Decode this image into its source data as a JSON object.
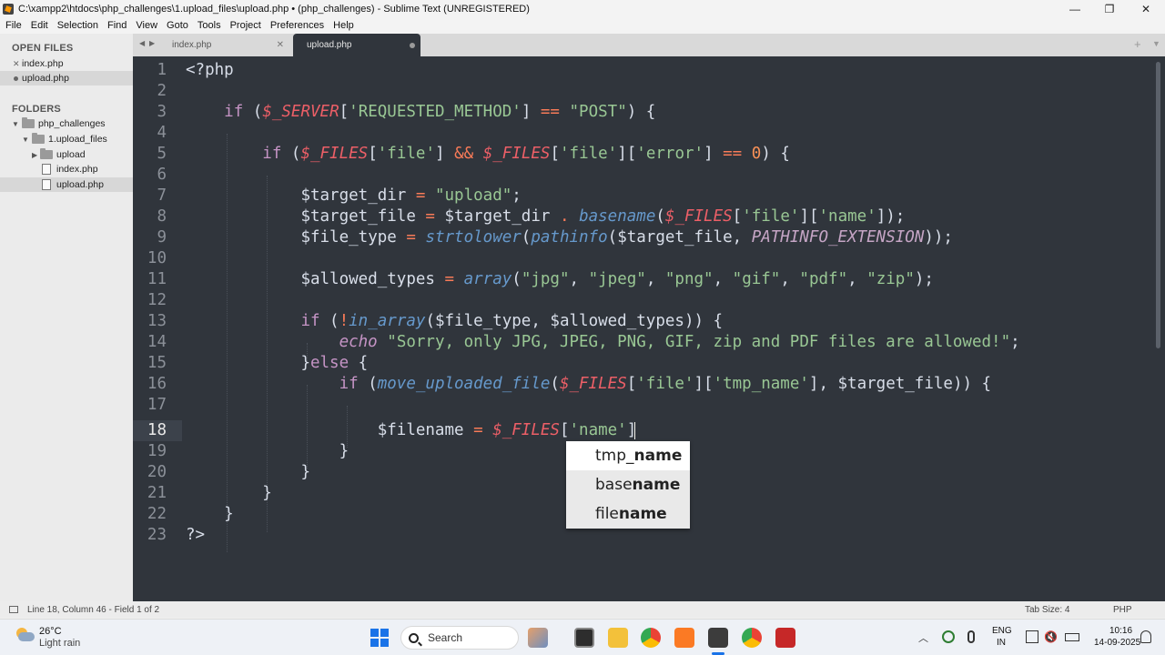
{
  "window": {
    "title": "C:\\xampp2\\htdocs\\php_challenges\\1.upload_files\\upload.php • (php_challenges) - Sublime Text (UNREGISTERED)",
    "min": "—",
    "max": "❐",
    "close": "✕"
  },
  "menu": [
    "File",
    "Edit",
    "Selection",
    "Find",
    "View",
    "Goto",
    "Tools",
    "Project",
    "Preferences",
    "Help"
  ],
  "sidebar": {
    "open_files_header": "OPEN FILES",
    "open_files": [
      {
        "label": "index.php"
      },
      {
        "label": "upload.php"
      }
    ],
    "folders_header": "FOLDERS",
    "tree": [
      {
        "label": "php_challenges"
      },
      {
        "label": "1.upload_files"
      },
      {
        "label": "upload"
      },
      {
        "label": "index.php"
      },
      {
        "label": "upload.php"
      }
    ]
  },
  "tabs": [
    {
      "label": "index.php"
    },
    {
      "label": "upload.php"
    }
  ],
  "gutter": [
    "1",
    "2",
    "3",
    "4",
    "5",
    "6",
    "7",
    "8",
    "9",
    "10",
    "11",
    "12",
    "13",
    "14",
    "15",
    "16",
    "17",
    "18",
    "19",
    "20",
    "21",
    "22",
    "23"
  ],
  "code": {
    "l1": "<?php",
    "l3_if": "if",
    "l3_a": " (",
    "l3_server": "$_SERVER",
    "l3_b": "[",
    "l3_key": "'REQUESTED_METHOD'",
    "l3_c": "] ",
    "l3_eq": "==",
    "l3_d": " ",
    "l3_post": "\"POST\"",
    "l3_e": ") {",
    "l5_if": "if",
    "l5_a": " (",
    "l5_files1": "$_FILES",
    "l5_b": "[",
    "l5_file1": "'file'",
    "l5_c": "] ",
    "l5_and": "&&",
    "l5_d": " ",
    "l5_files2": "$_FILES",
    "l5_e": "[",
    "l5_file2": "'file'",
    "l5_f": "][",
    "l5_error": "'error'",
    "l5_g": "] ",
    "l5_eq": "==",
    "l5_h": " ",
    "l5_zero": "0",
    "l5_i": ") {",
    "l7_var": "$target_dir",
    "l7_a": " ",
    "l7_eq": "=",
    "l7_b": " ",
    "l7_str": "\"upload\"",
    "l7_c": ";",
    "l8_var": "$target_file",
    "l8_a": " ",
    "l8_eq": "=",
    "l8_b": " ",
    "l8_var2": "$target_dir",
    "l8_c": " ",
    "l8_dot": ".",
    "l8_d": " ",
    "l8_fn": "basename",
    "l8_e": "(",
    "l8_files": "$_FILES",
    "l8_f": "[",
    "l8_file": "'file'",
    "l8_g": "][",
    "l8_name": "'name'",
    "l8_h": "]);",
    "l9_var": "$file_type",
    "l9_a": " ",
    "l9_eq": "=",
    "l9_b": " ",
    "l9_fn1": "strtolower",
    "l9_c": "(",
    "l9_fn2": "pathinfo",
    "l9_d": "(",
    "l9_var2": "$target_file",
    "l9_e": ", ",
    "l9_const": "PATHINFO_EXTENSION",
    "l9_f": "));",
    "l11_var": "$allowed_types",
    "l11_a": " ",
    "l11_eq": "=",
    "l11_b": " ",
    "l11_fn": "array",
    "l11_c": "(",
    "l11_s1": "\"jpg\"",
    "l11_d": ", ",
    "l11_s2": "\"jpeg\"",
    "l11_e": ", ",
    "l11_s3": "\"png\"",
    "l11_f": ", ",
    "l11_s4": "\"gif\"",
    "l11_g": ", ",
    "l11_s5": "\"pdf\"",
    "l11_h": ", ",
    "l11_s6": "\"zip\"",
    "l11_i": ");",
    "l13_if": "if",
    "l13_a": " (",
    "l13_not": "!",
    "l13_fn": "in_array",
    "l13_b": "(",
    "l13_v1": "$file_type",
    "l13_c": ", ",
    "l13_v2": "$allowed_types",
    "l13_d": ")) {",
    "l14_echo": "echo",
    "l14_a": " ",
    "l14_str": "\"Sorry, only JPG, JPEG, PNG, GIF, zip and PDF files are allowed!\"",
    "l14_b": ";",
    "l15_a": "}",
    "l15_else": "else",
    "l15_b": " {",
    "l16_if": "if",
    "l16_a": " (",
    "l16_fn": "move_uploaded_file",
    "l16_b": "(",
    "l16_files": "$_FILES",
    "l16_c": "[",
    "l16_file": "'file'",
    "l16_d": "][",
    "l16_tmp": "'tmp_name'",
    "l16_e": "], ",
    "l16_var": "$target_file",
    "l16_f": ")) {",
    "l18_var": "$filename",
    "l18_a": " ",
    "l18_eq": "=",
    "l18_b": " ",
    "l18_files": "$_FILES",
    "l18_c": "[",
    "l18_str": "'name'",
    "l18_d": "]",
    "l19": "}",
    "l20": "}",
    "l21": "}",
    "l22": "}",
    "l23": "?>"
  },
  "autocomplete": {
    "items": [
      {
        "pre": "tmp_",
        "match": "name"
      },
      {
        "pre": "base",
        "match": "name"
      },
      {
        "pre": "file",
        "match": "name"
      }
    ]
  },
  "status": {
    "position": "Line 18, Column 46 - Field 1 of 2",
    "tab_size": "Tab Size: 4",
    "syntax": "PHP"
  },
  "taskbar": {
    "temp": "26°C",
    "weather": "Light rain",
    "search": "Search",
    "lang1": "ENG",
    "lang2": "IN",
    "time": "10:16",
    "date": "14-09-2025"
  },
  "colors": {
    "editor_bg": "#30353c",
    "keyword": "#c594c5",
    "superglobal": "#ec5f67",
    "string": "#99c794",
    "function": "#6699cc",
    "constant": "#f99157"
  }
}
